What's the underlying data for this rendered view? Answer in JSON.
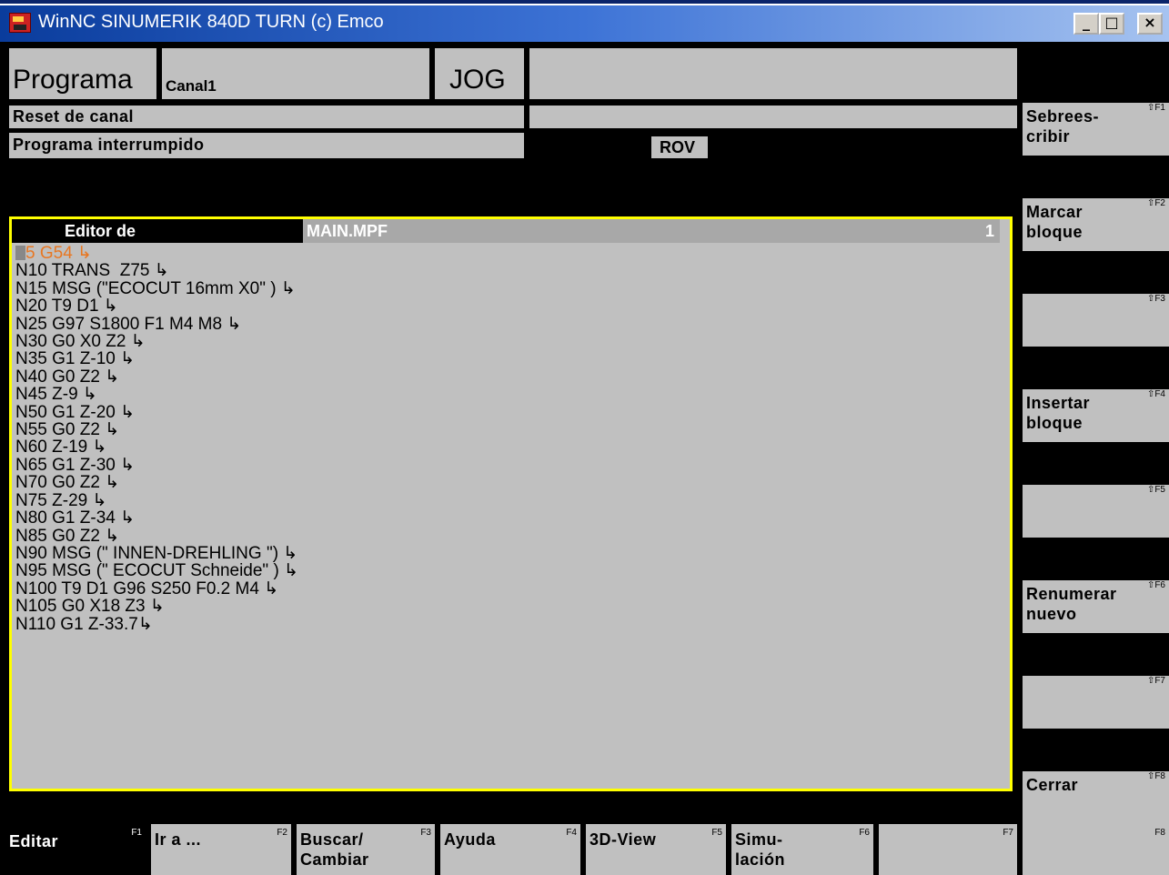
{
  "window": {
    "title": "WinNC SINUMERIK 840D TURN (c) Emco",
    "controls": [
      "_",
      "□",
      "×"
    ]
  },
  "header": {
    "area": "Programa",
    "channel": "Canal1",
    "mode": "JOG",
    "channel_status": "Reset de canal",
    "program_status": "Programa interrumpido",
    "rov": "ROV"
  },
  "editor": {
    "title": "Editor de",
    "filename": "MAIN.MPF",
    "line_number": "1",
    "lines": [
      "5 G54 ↳",
      "N10 TRANS  Z75 ↳",
      "N15 MSG (\"ECOCUT 16mm X0\" ) ↳",
      "N20 T9 D1 ↳",
      "N25 G97 S1800 F1 M4 M8 ↳",
      "N30 G0 X0 Z2 ↳",
      "N35 G1 Z-10 ↳",
      "N40 G0 Z2 ↳",
      "N45 Z-9 ↳",
      "N50 G1 Z-20 ↳",
      "N55 G0 Z2 ↳",
      "N60 Z-19 ↳",
      "N65 G1 Z-30 ↳",
      "N70 G0 Z2 ↳",
      "N75 Z-29 ↳",
      "N80 G1 Z-34 ↳",
      "N85 G0 Z2 ↳",
      "N90 MSG (\" INNEN-DREHLING \") ↳",
      "N95 MSG (\" ECOCUT Schneide\" ) ↳",
      "N100 T9 D1 G96 S250 F0.2 M4 ↳",
      "N105 G0 X18 Z3 ↳",
      "N110 G1 Z-33.7↳"
    ]
  },
  "vertical_softkeys": [
    {
      "label": "Sebrees-\ncribir",
      "key": "⇧F1"
    },
    {
      "label": "Marcar\nbloque",
      "key": "⇧F2"
    },
    {
      "label": "",
      "key": "⇧F3"
    },
    {
      "label": "Insertar\nbloque",
      "key": "⇧F4"
    },
    {
      "label": "",
      "key": "⇧F5"
    },
    {
      "label": "Renumerar\nnuevo",
      "key": "⇧F6"
    },
    {
      "label": "",
      "key": "⇧F7"
    },
    {
      "label": "Cerrar",
      "key": "⇧F8"
    }
  ],
  "horizontal_softkeys": [
    {
      "label": "Editar",
      "key": "F1"
    },
    {
      "label": "Ir a ...",
      "key": "F2"
    },
    {
      "label": "Buscar/\nCambiar",
      "key": "F3"
    },
    {
      "label": "Ayuda",
      "key": "F4"
    },
    {
      "label": "3D-View",
      "key": "F5"
    },
    {
      "label": "Simu-\nlación",
      "key": "F6"
    },
    {
      "label": "",
      "key": "F7"
    },
    {
      "label": "",
      "key": "F8"
    }
  ],
  "colors": {
    "panel": "#c0c0c0",
    "editor_border": "#ffff00",
    "current_line": "#e87722",
    "title_gradient_start": "#0a3c9c"
  }
}
